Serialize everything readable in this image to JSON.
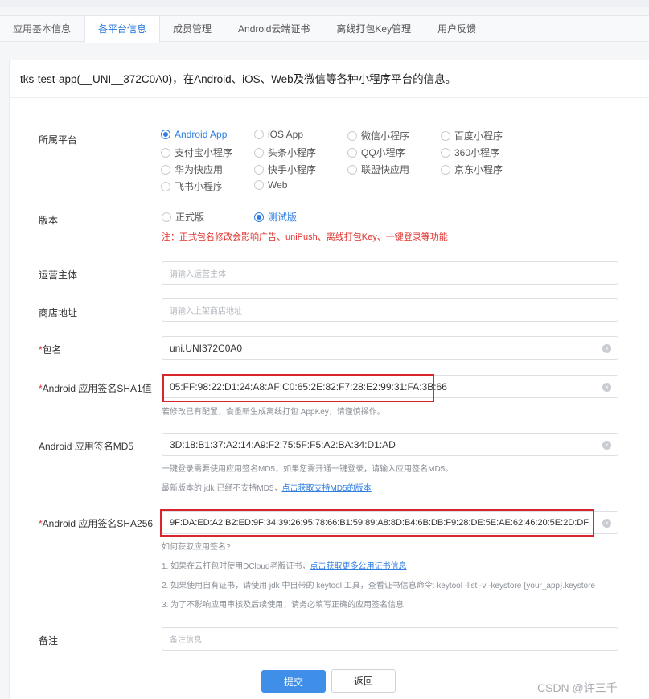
{
  "tabs": [
    {
      "label": "应用基本信息",
      "active": false
    },
    {
      "label": "各平台信息",
      "active": true
    },
    {
      "label": "成员管理",
      "active": false
    },
    {
      "label": "Android云端证书",
      "active": false
    },
    {
      "label": "离线打包Key管理",
      "active": false
    },
    {
      "label": "用户反馈",
      "active": false
    }
  ],
  "panel_title": "tks-test-app(__UNI__372C0A0)，在Android、iOS、Web及微信等各种小程序平台的信息。",
  "platform": {
    "label": "所属平台",
    "options": [
      {
        "label": "Android App",
        "checked": true
      },
      {
        "label": "iOS App",
        "checked": false
      },
      {
        "label": "微信小程序",
        "checked": false
      },
      {
        "label": "百度小程序",
        "checked": false
      },
      {
        "label": "支付宝小程序",
        "checked": false
      },
      {
        "label": "头条小程序",
        "checked": false
      },
      {
        "label": "QQ小程序",
        "checked": false
      },
      {
        "label": "360小程序",
        "checked": false
      },
      {
        "label": "华为快应用",
        "checked": false
      },
      {
        "label": "快手小程序",
        "checked": false
      },
      {
        "label": "联盟快应用",
        "checked": false
      },
      {
        "label": "京东小程序",
        "checked": false
      },
      {
        "label": "飞书小程序",
        "checked": false
      },
      {
        "label": "Web",
        "checked": false
      }
    ]
  },
  "version": {
    "label": "版本",
    "options": [
      {
        "label": "正式版",
        "checked": false
      },
      {
        "label": "测试版",
        "checked": true
      }
    ],
    "warning": "注：正式包名修改会影响广告、uniPush、离线打包Key、一键登录等功能"
  },
  "operator": {
    "label": "运营主体",
    "placeholder": "请输入运营主体",
    "value": ""
  },
  "store": {
    "label": "商店地址",
    "placeholder": "请输入上架商店地址",
    "value": ""
  },
  "package": {
    "required": "*",
    "label": "包名",
    "value": "uni.UNI372C0A0"
  },
  "sha1": {
    "required": "*",
    "label": "Android 应用签名SHA1值",
    "value": "05:FF:98:22:D1:24:A8:AF:C0:65:2E:82:F7:28:E2:99:31:FA:3B:66",
    "hint": "若修改已有配置，会重新生成离线打包 AppKey，请谨慎操作。"
  },
  "md5": {
    "label": "Android 应用签名MD5",
    "value": "3D:18:B1:37:A2:14:A9:F2:75:5F:F5:A2:BA:34:D1:AD",
    "hint1": "一键登录需要使用应用签名MD5，如果您需开通一键登录，请输入应用签名MD5。",
    "hint2": "最新版本的 jdk 已经不支持MD5，",
    "hint2_link": "点击获取支持MD5的版本"
  },
  "sha256": {
    "required": "*",
    "label": "Android 应用签名SHA256",
    "value": "9F:DA:ED:A2:B2:ED:9F:34:39:26:95:78:66:B1:59:89:A8:8D:B4:6B:DB:F9:28:DE:5E:AE:62:46:20:5E:2D:DF",
    "how": "如何获取应用签名?",
    "step1": "1. 如果在云打包时使用DCloud老版证书，",
    "step1_link": "点击获取更多公用证书信息",
    "step2": "2. 如果使用自有证书，请使用 jdk 中自带的 keytool 工具，查看证书信息命令: keytool -list -v -keystore {your_app}.keystore",
    "step3": "3. 为了不影响应用审核及后续使用，请务必填写正确的应用签名信息"
  },
  "remark": {
    "label": "备注",
    "placeholder": "备注信息",
    "value": ""
  },
  "buttons": {
    "submit": "提交",
    "back": "返回"
  },
  "clear_glyph": "×",
  "watermark": "CSDN @许三千",
  "colors": {
    "accent": "#2f7de1",
    "primary_button": "#3f8fe9",
    "warning": "#e0332e",
    "highlight_box": "#d9262c"
  }
}
